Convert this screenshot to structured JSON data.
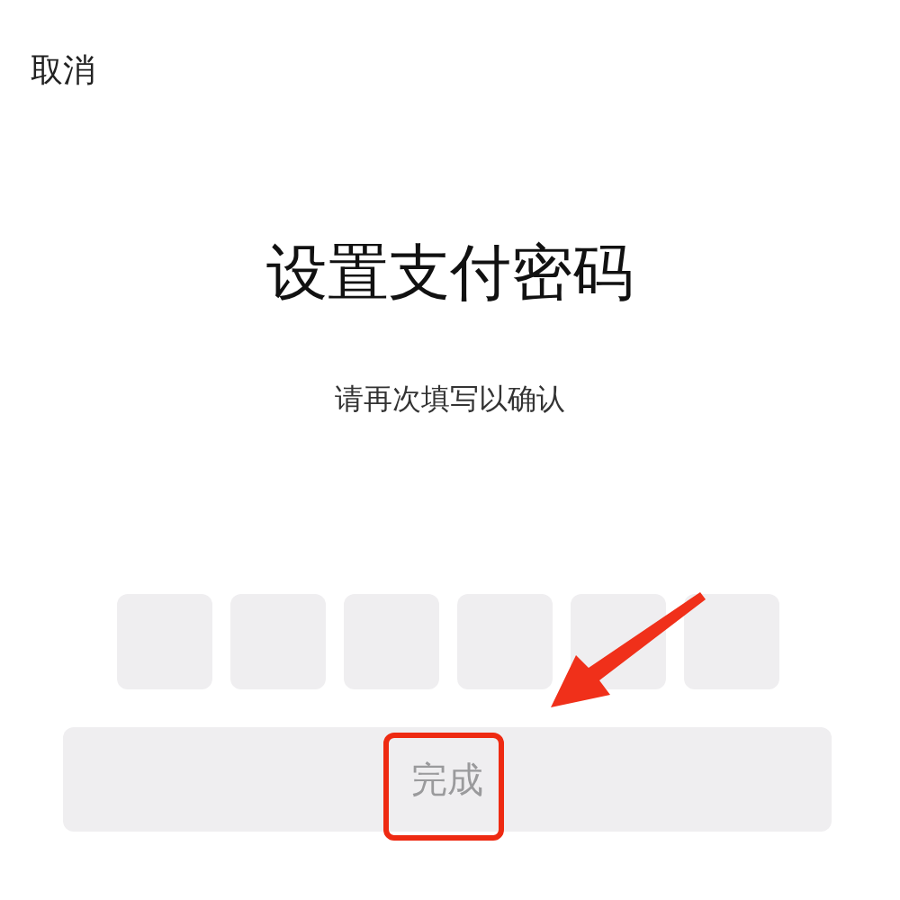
{
  "cancel": "取消",
  "title": "设置支付密码",
  "subtitle": "请再次填写以确认",
  "pin_boxes": [
    {
      "filled": false
    },
    {
      "filled": false
    },
    {
      "filled": false
    },
    {
      "filled": false
    },
    {
      "filled": false
    },
    {
      "filled": false
    }
  ],
  "done_button": {
    "label": "完成",
    "disabled": true
  }
}
